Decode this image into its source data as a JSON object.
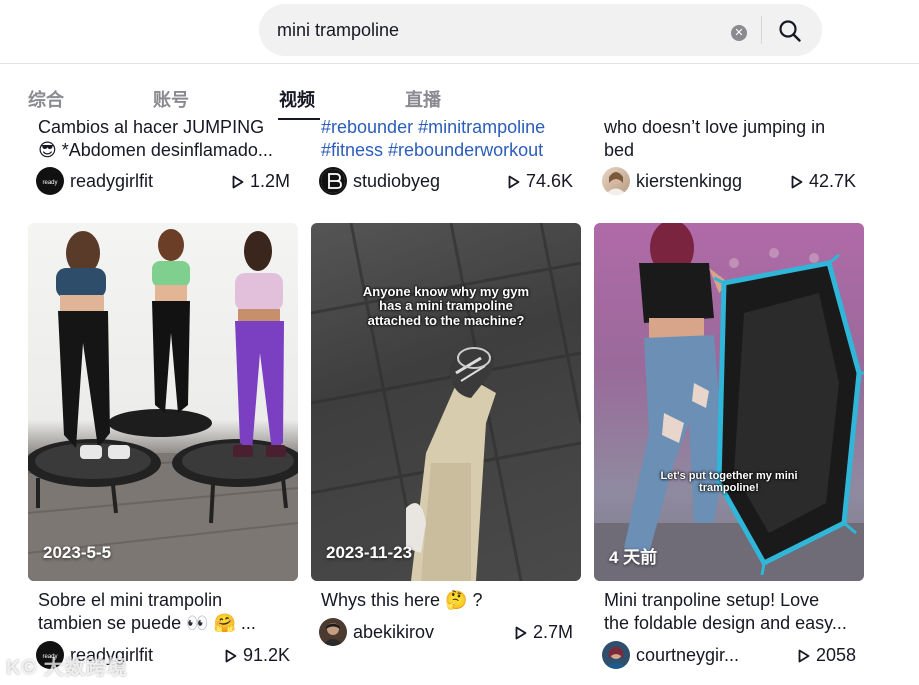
{
  "search": {
    "value": "mini trampoline",
    "placeholder": ""
  },
  "tabs": [
    {
      "label": "综合"
    },
    {
      "label": "账号"
    },
    {
      "label": "视频"
    },
    {
      "label": "直播"
    }
  ],
  "active_tab": "视频",
  "top_row": [
    {
      "desc_line1": "Cambios al hacer JUMPING",
      "desc_line2": "😎 *Abdomen desinflamado...",
      "author": "readygirlfit",
      "views": "1.2M"
    },
    {
      "desc_line1": "#rebounder #minitrampoline",
      "desc_line2": "#fitness #rebounderworkout",
      "author": "studiobyeg",
      "views": "74.6K"
    },
    {
      "desc_line1": "who doesn’t love jumping in",
      "desc_line2": "bed",
      "author": "kierstenkingg",
      "views": "42.7K"
    }
  ],
  "bottom_row": [
    {
      "date": "2023-5-5",
      "overlay": "",
      "desc_line1": "Sobre el mini trampolin",
      "desc_line2": "tambien se puede 👀 🤗 ...",
      "author": "readygirlfit",
      "views": "91.2K"
    },
    {
      "date": "2023-11-23",
      "overlay": "Anyone know why my gym has a mini trampoline attached to the machine?",
      "desc_line1": "Whys this here 🤔 ?",
      "desc_line2": "",
      "author": "abekikirov",
      "views": "2.7M"
    },
    {
      "date": "4 天前",
      "overlay": "Let's put together my mini trampoline!",
      "desc_line1": "Mini tranpoline setup! Love",
      "desc_line2": "the foldable design and easy...",
      "author": "courtneygir...",
      "views": "2058"
    }
  ],
  "watermark": "K© 大数跨境",
  "icons": {
    "search": "search-icon",
    "clear": "clear-icon",
    "play": "play-icon"
  },
  "colors": {
    "hashtag": "#2b5db9",
    "text": "#161823",
    "muted": "#8a8b91"
  }
}
